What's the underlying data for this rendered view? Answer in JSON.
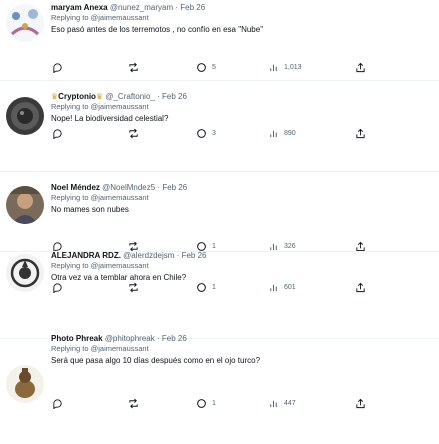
{
  "tweets": [
    {
      "name": "maryam Anexa",
      "handle": "@nunez_maryam",
      "date": "Feb 26",
      "reply_prefix": "Replying to",
      "reply_to": "@jaimemaussant",
      "text": "Eso pasó antes de los terremotos , no confío en esa \"Nube\"",
      "replies": "",
      "retweets": "",
      "likes": "5",
      "views": "1,013"
    },
    {
      "name": "Cryptonio",
      "handle": "@_Craftonio_",
      "date": "Feb 26",
      "reply_prefix": "Replying to",
      "reply_to": "@jaimemaussant",
      "text": "Nope! La biodiversidad celestial?",
      "replies": "",
      "retweets": "",
      "likes": "3",
      "views": "890"
    },
    {
      "name": "Noel Méndez",
      "handle": "@NoelMndez5",
      "date": "Feb 26",
      "reply_prefix": "Replying to",
      "reply_to": "@jaimemaussant",
      "text": "No mames son nubes",
      "replies": "",
      "retweets": "",
      "likes": "1",
      "views": "326"
    },
    {
      "name": "ALEJANDRA RDZ.",
      "handle": "@alerdzdejsm",
      "date": "Feb 26",
      "reply_prefix": "Replying to",
      "reply_to": "@jaimemaussant",
      "text": "Otra vez va a temblar ahora en Chile?",
      "replies": "",
      "retweets": "",
      "likes": "1",
      "views": "601"
    },
    {
      "name": "Photo Phreak",
      "handle": "@phitophreak",
      "date": "Feb 26",
      "reply_prefix": "Replying to",
      "reply_to": "@jaimemaussant",
      "text": "Será que pasa algo 10 días después como en el ojo turco?",
      "replies": "",
      "retweets": "",
      "likes": "1",
      "views": "447"
    }
  ],
  "colors": {
    "text": "#0f1419",
    "secondary": "#536471",
    "divider": "#eff3f4"
  },
  "icons": [
    "reply-icon",
    "retweet-icon",
    "like-icon",
    "views-icon",
    "share-icon",
    "verified-emoji-icon"
  ]
}
